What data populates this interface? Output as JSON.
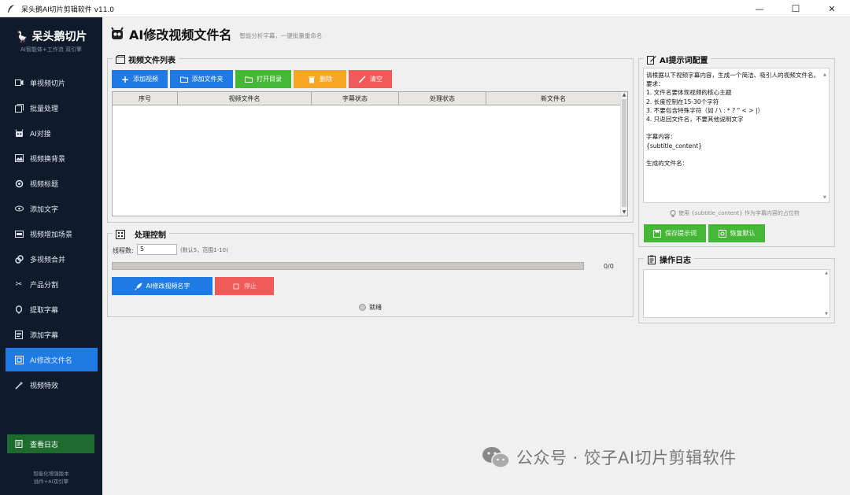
{
  "window": {
    "title": "呆头鹅AI切片剪辑软件 v11.0",
    "minimize": "—",
    "maximize": "☐",
    "close": "✕"
  },
  "sidebar": {
    "brand": "呆头鹅切片",
    "subtitle": "AI智能体+工作流 双引擎",
    "items": [
      {
        "label": "单视频切片",
        "icon": "video-icon"
      },
      {
        "label": "批量处理",
        "icon": "batch-icon"
      },
      {
        "label": "AI对接",
        "icon": "robot-icon"
      },
      {
        "label": "视频换背景",
        "icon": "background-icon"
      },
      {
        "label": "视频标题",
        "icon": "title-icon"
      },
      {
        "label": "添加文字",
        "icon": "text-icon"
      },
      {
        "label": "视频增加场景",
        "icon": "scene-icon"
      },
      {
        "label": "多视频合并",
        "icon": "merge-icon"
      },
      {
        "label": "产品分割",
        "icon": "scissors-icon"
      },
      {
        "label": "提取字幕",
        "icon": "extract-icon"
      },
      {
        "label": "添加字幕",
        "icon": "subtitle-icon"
      },
      {
        "label": "AI修改文件名",
        "icon": "rename-icon"
      },
      {
        "label": "视频特效",
        "icon": "effects-icon"
      }
    ],
    "active_index": 11,
    "log_button": "查看日志",
    "footer_line1": "智能化增强版本",
    "footer_line2": "插件+AI双引擎"
  },
  "header": {
    "title": "AI修改视频文件名",
    "subtitle": "智能分析字幕，一键批量重命名"
  },
  "file_list": {
    "group_label": "视频文件列表",
    "buttons": {
      "add_video": "添加视频",
      "add_folder": "添加文件夹",
      "open_dir": "打开目录",
      "delete": "删除",
      "clear": "清空"
    },
    "columns": [
      "序号",
      "视频文件名",
      "字幕状态",
      "处理状态",
      "新文件名"
    ]
  },
  "control": {
    "group_label": "处理控制",
    "threads_label": "线程数:",
    "threads_value": "5",
    "threads_hint": "(默认5，范围1-10)",
    "progress": 0,
    "progress_text": "0/0",
    "start_button": "AI修改视频名字",
    "stop_button": "停止",
    "status": "就绪"
  },
  "prompt": {
    "group_label": "AI提示词配置",
    "text": "请根据以下视频字幕内容，生成一个简洁、吸引人的视频文件名。\n要求：\n1. 文件名要体现视频的核心主题\n2. 长度控制在15-30个字符\n3. 不要包含特殊字符（如 / \\ : * ? \" < > |）\n4. 只返回文件名，不要其他说明文字\n\n字幕内容：\n{subtitle_content}\n\n生成的文件名：",
    "hint": "使用 {subtitle_content} 作为字幕内容的占位符",
    "save_button": "保存提示词",
    "reset_button": "恢复默认"
  },
  "log": {
    "group_label": "操作日志"
  },
  "watermark": "公众号 · 饺子AI切片剪辑软件",
  "colors": {
    "sidebar_bg": "#0f1a2b",
    "accent_blue": "#1e7be6",
    "green": "#44b835",
    "orange": "#f5a623",
    "red": "#f25a5a",
    "log_green": "#1e6b2e"
  }
}
